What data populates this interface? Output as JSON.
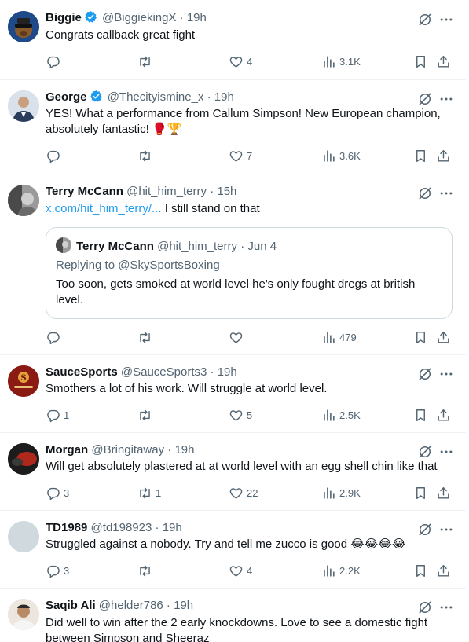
{
  "tweets": [
    {
      "name": "Biggie",
      "verified": true,
      "handle": "@BiggiekingX",
      "time": "19h",
      "text": "Congrats callback great fight",
      "replies": "",
      "retweets": "",
      "likes": "4",
      "views": "3.1K"
    },
    {
      "name": "George",
      "verified": true,
      "handle": "@Thecityismine_x",
      "time": "19h",
      "text": "YES! What a performance from Callum Simpson! New European champion, absolutely fantastic! 🥊🏆",
      "replies": "",
      "retweets": "",
      "likes": "7",
      "views": "3.6K"
    },
    {
      "name": "Terry McCann",
      "verified": false,
      "handle": "@hit_him_terry",
      "time": "15h",
      "link": "x.com/hit_him_terry/...",
      "text": " I still stand on that",
      "quote": {
        "name": "Terry McCann",
        "handle": "@hit_him_terry",
        "time": "Jun 4",
        "replying": "Replying to @SkySportsBoxing",
        "text": "Too soon, gets smoked at world level he's only fought dregs at british level."
      },
      "replies": "",
      "retweets": "",
      "likes": "",
      "views": "479"
    },
    {
      "name": "SauceSports",
      "verified": false,
      "handle": "@SauceSports3",
      "time": "19h",
      "text": "Smothers a lot of his work. Will struggle at world level.",
      "replies": "1",
      "retweets": "",
      "likes": "5",
      "views": "2.5K"
    },
    {
      "name": "Morgan",
      "verified": false,
      "handle": "@Bringitaway",
      "time": "19h",
      "text": "Will get absolutely plastered at at world level with an egg shell chin like that",
      "replies": "3",
      "retweets": "1",
      "likes": "22",
      "views": "2.9K"
    },
    {
      "name": "TD1989",
      "verified": false,
      "handle": "@td198923",
      "time": "19h",
      "text": "Struggled against a nobody. Try and tell me zucco is good 😂😂😂😂",
      "replies": "3",
      "retweets": "",
      "likes": "4",
      "views": "2.2K"
    },
    {
      "name": "Saqib Ali",
      "verified": false,
      "handle": "@helder786",
      "time": "19h",
      "text": "Did well to win after the 2 early knockdowns. Love to see a domestic fight between Simpson and Sheeraz"
    }
  ],
  "icons": {
    "reply": "reply-icon",
    "retweet": "retweet-icon",
    "like": "heart-icon",
    "views": "views-icon",
    "bookmark": "bookmark-icon",
    "share": "share-icon",
    "grok": "grok-icon",
    "more": "more-icon",
    "verified": "verified-badge-icon"
  },
  "colors": {
    "verified": "#1d9bf0",
    "link": "#1d9bf0",
    "muted": "#536471",
    "text": "#0f1419"
  }
}
